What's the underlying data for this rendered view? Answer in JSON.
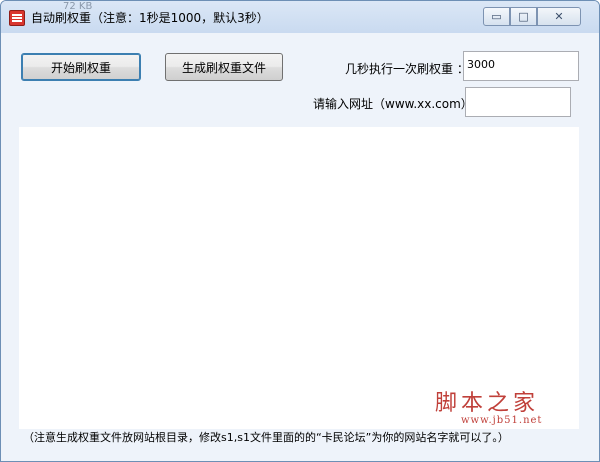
{
  "window": {
    "title": "自动刷权重（注意：1秒是1000，默认3秒）",
    "ghost_text": "72 KB"
  },
  "caption": {
    "minimize_glyph": "▭",
    "maximize_glyph": "□",
    "close_glyph": "✕"
  },
  "buttons": {
    "start_label": "开始刷权重",
    "generate_label": "生成刷权重文件"
  },
  "form": {
    "interval_label": "几秒执行一次刷权重 ：",
    "interval_value": "3000",
    "url_label": "请输入网址（www.xx.com）",
    "url_value": ""
  },
  "footer": {
    "note": "（注意生成权重文件放网站根目录，修改s1,s1文件里面的的“卡民论坛”为你的网站名字就可以了。）"
  },
  "watermark": {
    "text": "脚本之家",
    "url": "www.jb51.net"
  },
  "colors": {
    "accent": "#3c7fb1",
    "watermark": "#c0403a"
  }
}
